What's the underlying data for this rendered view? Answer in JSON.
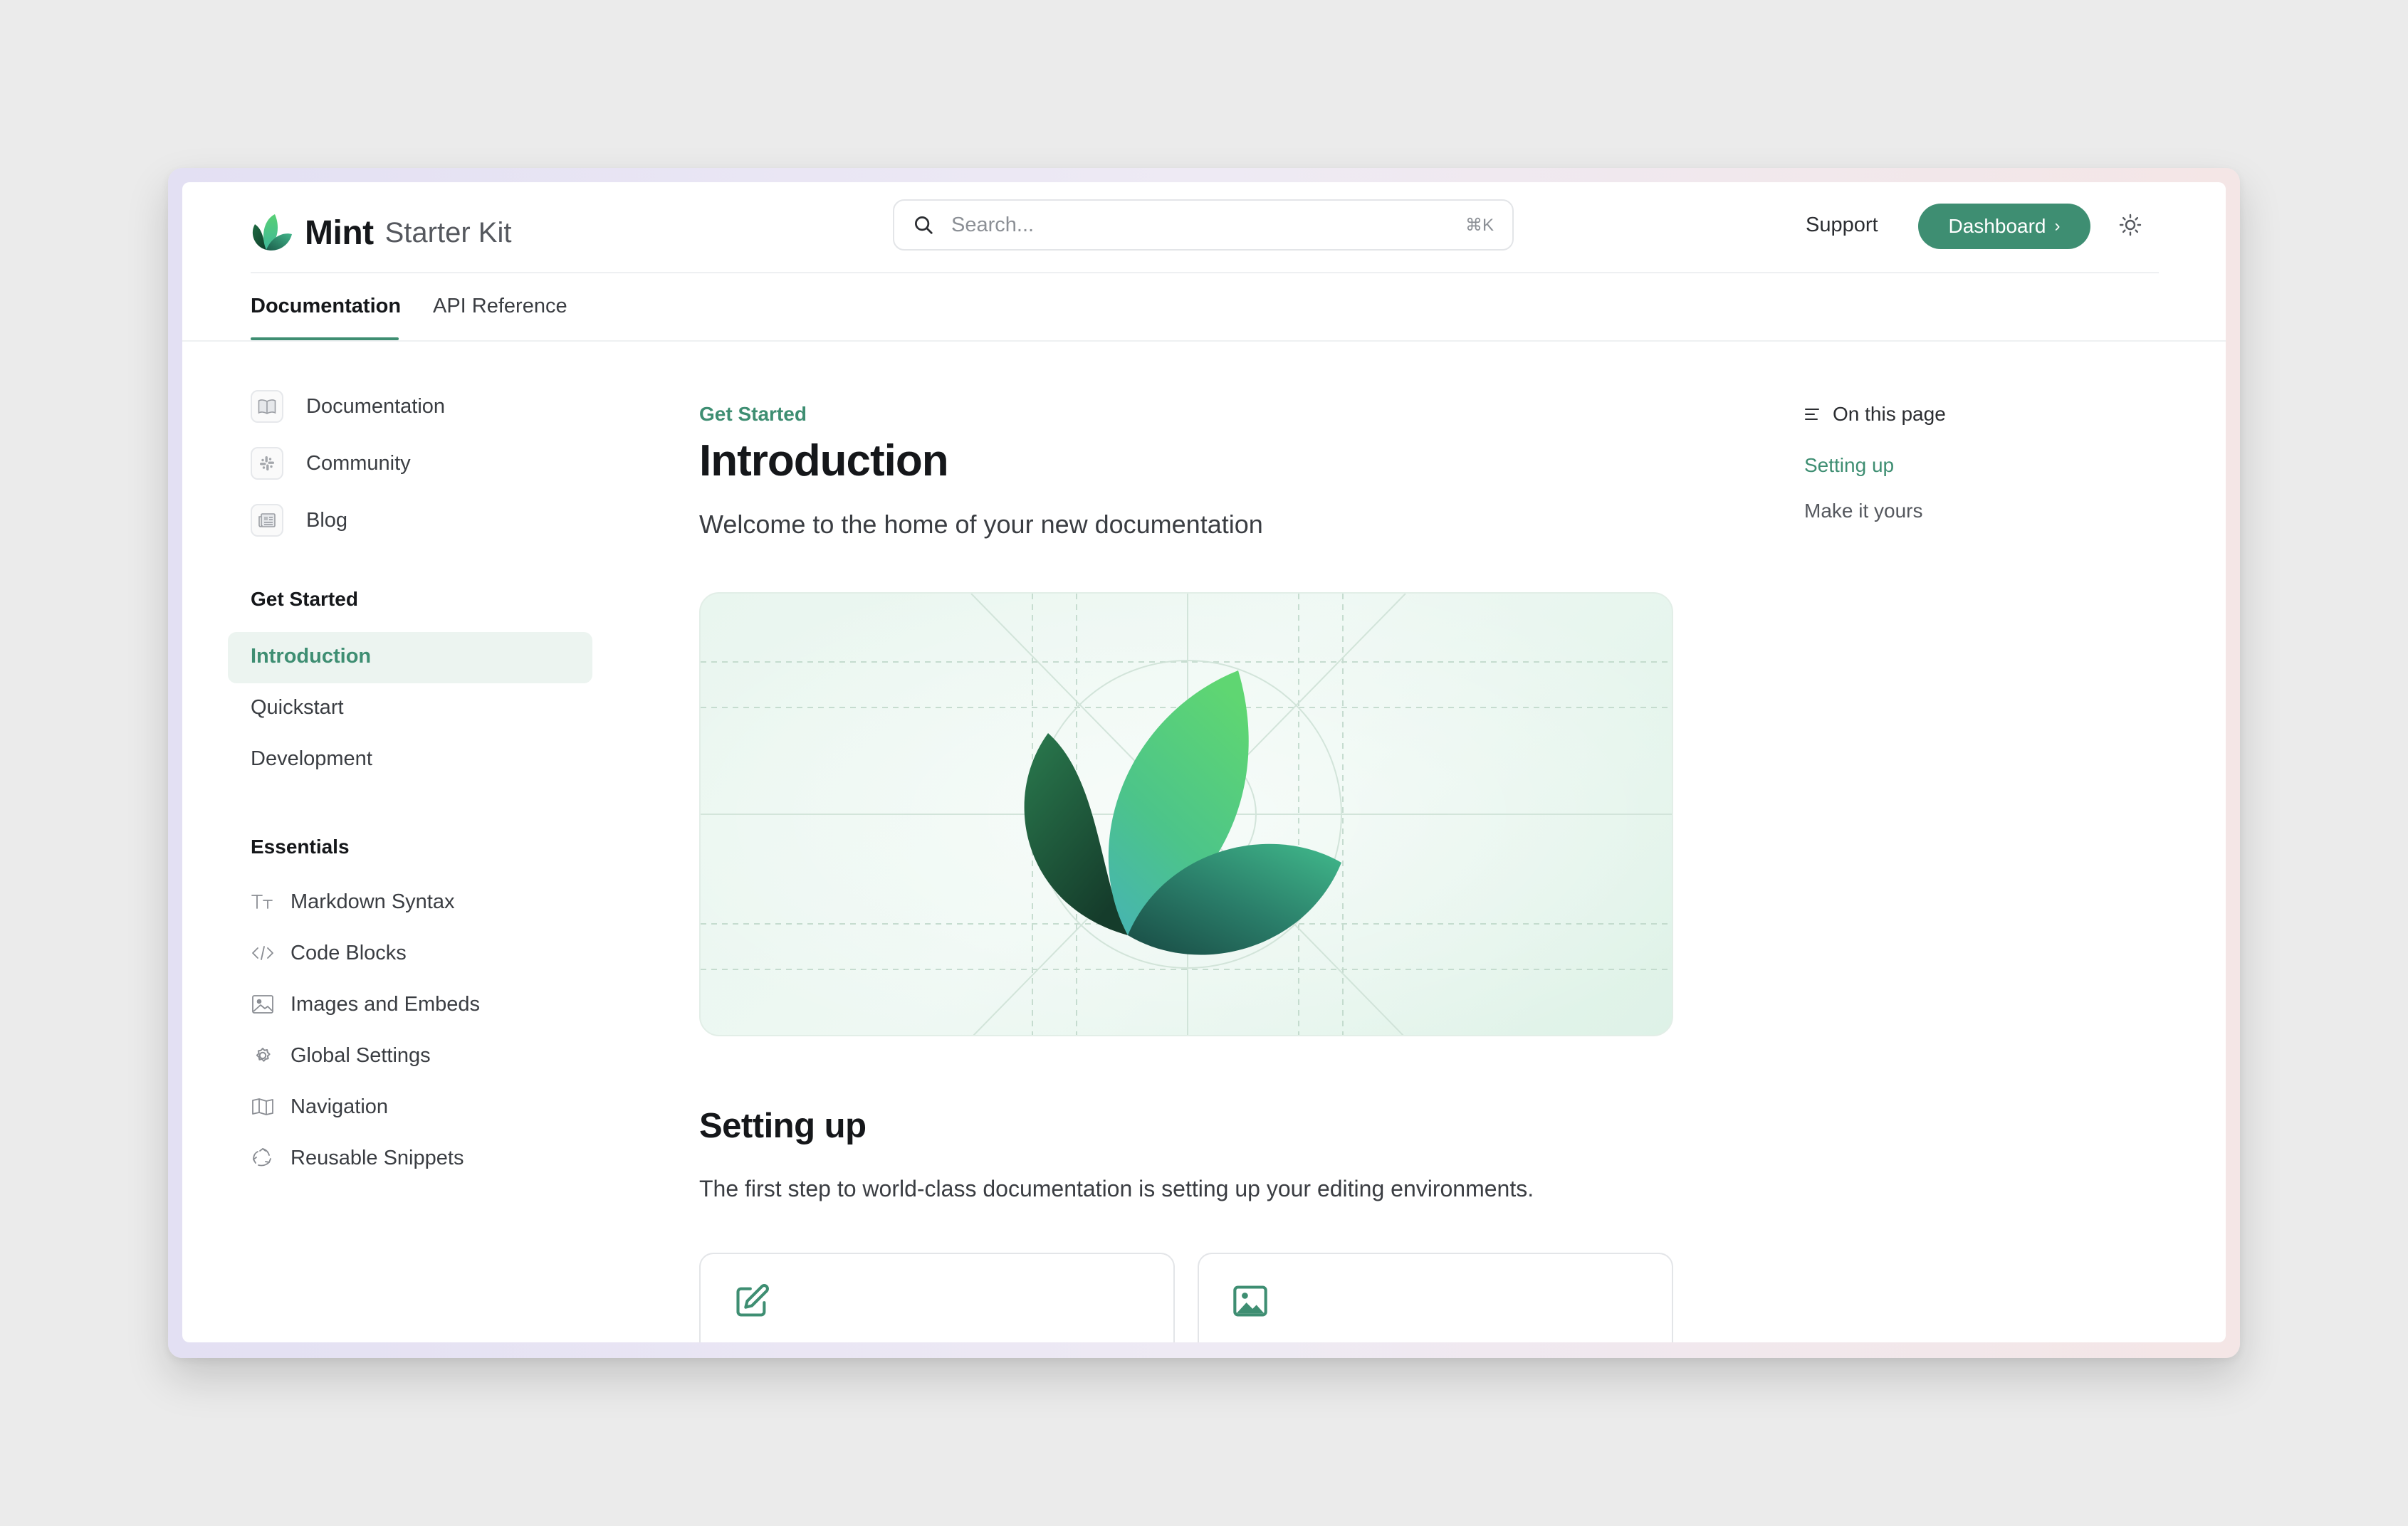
{
  "brand": {
    "name": "Mint",
    "subtitle": "Starter Kit",
    "accent": "#3e8e72"
  },
  "header": {
    "search_placeholder": "Search...",
    "search_shortcut": "⌘K",
    "support_label": "Support",
    "dashboard_label": "Dashboard"
  },
  "tabs": [
    {
      "label": "Documentation",
      "active": true
    },
    {
      "label": "API Reference",
      "active": false
    }
  ],
  "sidebar": {
    "anchors": [
      {
        "label": "Documentation",
        "icon": "book-icon"
      },
      {
        "label": "Community",
        "icon": "slack-icon"
      },
      {
        "label": "Blog",
        "icon": "newspaper-icon"
      }
    ],
    "groups": [
      {
        "heading": "Get Started",
        "items": [
          {
            "label": "Introduction",
            "active": true
          },
          {
            "label": "Quickstart"
          },
          {
            "label": "Development"
          }
        ]
      },
      {
        "heading": "Essentials",
        "items": [
          {
            "label": "Markdown Syntax",
            "icon": "text-size-icon"
          },
          {
            "label": "Code Blocks",
            "icon": "code-icon"
          },
          {
            "label": "Images and Embeds",
            "icon": "image-icon"
          },
          {
            "label": "Global Settings",
            "icon": "gear-icon"
          },
          {
            "label": "Navigation",
            "icon": "map-icon"
          },
          {
            "label": "Reusable Snippets",
            "icon": "recycle-icon"
          }
        ]
      }
    ]
  },
  "content": {
    "eyebrow": "Get Started",
    "title": "Introduction",
    "description": "Welcome to the home of your new documentation",
    "section_title": "Setting up",
    "section_description": "The first step to world-class documentation is setting up your editing environments.",
    "cards": [
      {
        "icon": "pencil-square-icon"
      },
      {
        "icon": "image-icon"
      }
    ]
  },
  "toc": {
    "heading": "On this page",
    "items": [
      {
        "label": "Setting up",
        "active": true
      },
      {
        "label": "Make it yours",
        "active": false
      }
    ]
  }
}
